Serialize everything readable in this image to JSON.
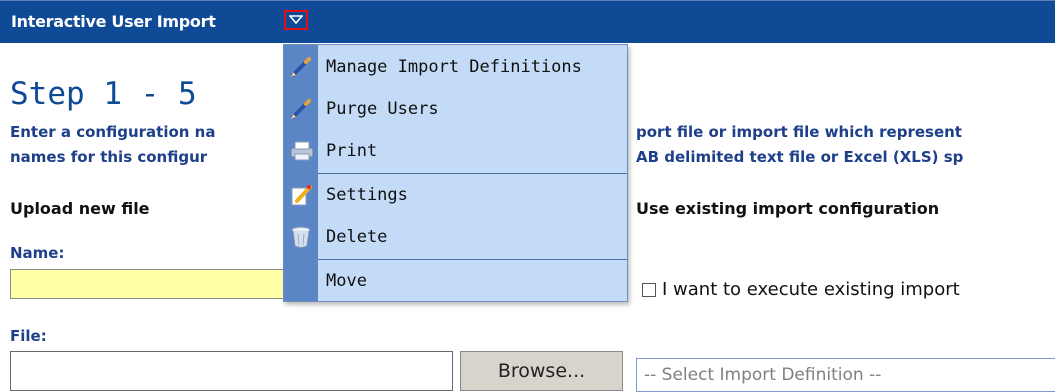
{
  "header": {
    "title": "Interactive User Import",
    "toggle_icon": "triangle-down-icon"
  },
  "page": {
    "step_title": "Step 1 - 5",
    "desc_line1_left": "Enter a configuration na",
    "desc_line1_right": "port file or import file which represent",
    "desc_line2_left": "names for this configur",
    "desc_line2_right": "AB delimited text file or Excel (XLS) sp",
    "upload_heading": "Upload new file",
    "existing_heading": "Use existing import configuration",
    "name_label": "Name:",
    "file_label": "File:",
    "name_value": "",
    "file_value": "",
    "browse_label": "Browse...",
    "checkbox_label": "I want to execute existing import",
    "checkbox_checked": false,
    "select_value": "-- Select Import Definition --"
  },
  "menu": {
    "items": [
      {
        "label": "Manage Import Definitions",
        "icon": "pencil-icon"
      },
      {
        "label": "Purge Users",
        "icon": "pencil-icon"
      },
      {
        "label": "Print",
        "icon": "printer-icon"
      },
      {
        "label": "Settings",
        "icon": "notepad-pencil-icon"
      },
      {
        "label": "Delete",
        "icon": "trash-can-icon"
      },
      {
        "label": "Move",
        "icon": ""
      }
    ]
  },
  "colors": {
    "titlebar": "#0f4a96",
    "menu_bg": "#c3dbf7",
    "menu_gutter": "#5a86c6",
    "name_input_bg": "#ffffa8",
    "toggle_border": "#e01010"
  }
}
